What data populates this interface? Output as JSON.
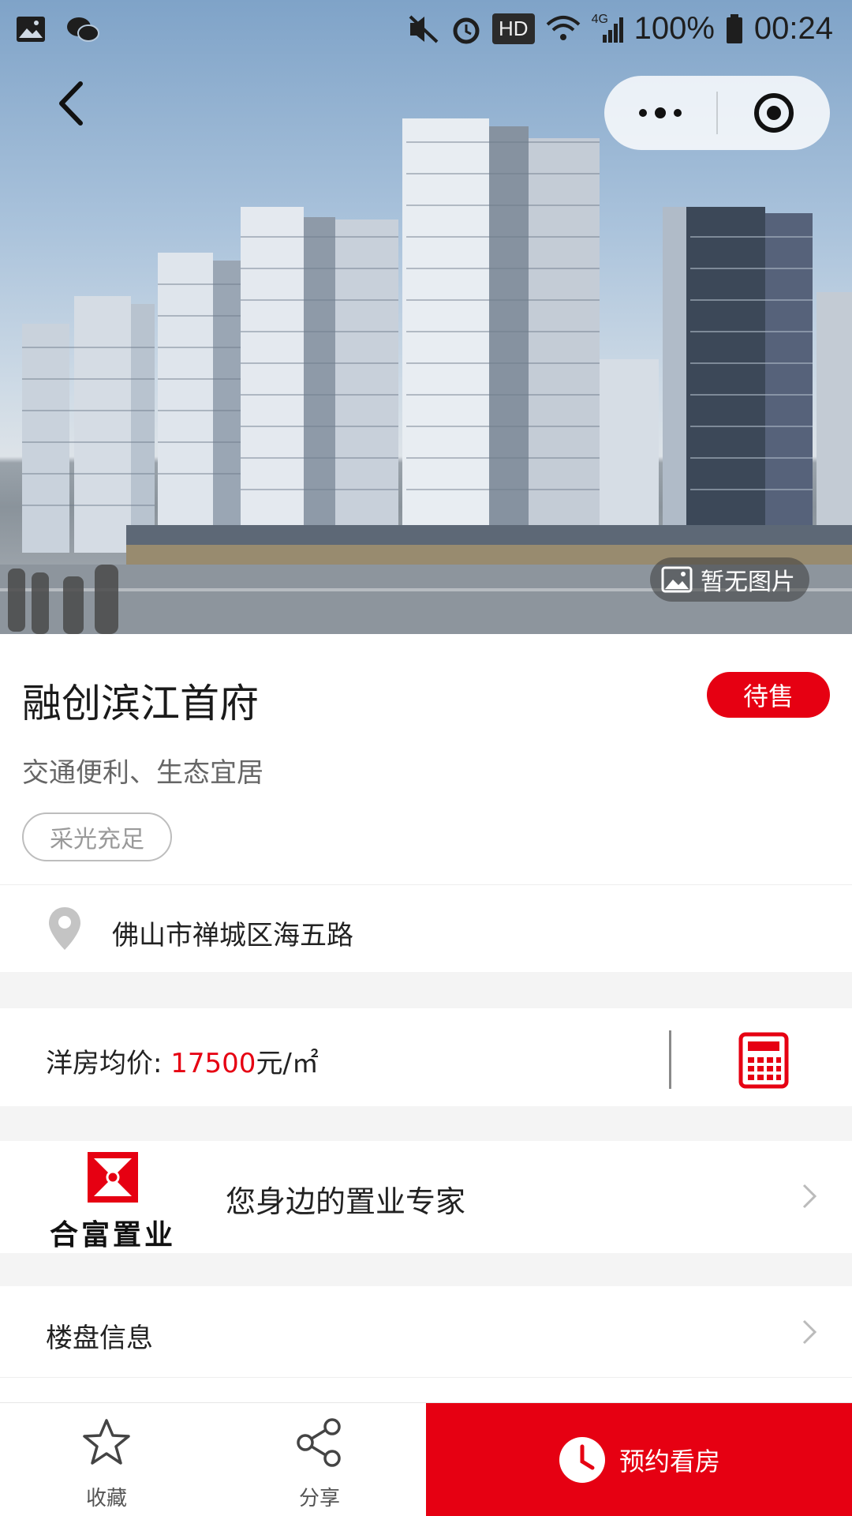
{
  "status_bar": {
    "battery": "100%",
    "time": "00:24",
    "network": "HD",
    "signal_type": "4G",
    "left_icons": [
      "image-notification-icon",
      "wechat-icon"
    ],
    "right_icons": [
      "mute-vibrate-icon",
      "alarm-icon",
      "wifi-icon",
      "signal-icon",
      "battery-icon"
    ]
  },
  "hero": {
    "placeholder_label": "暂无图片"
  },
  "project": {
    "name": "融创滨江首府",
    "status": "待售",
    "slogan": "交通便利、生态宜居",
    "tags": [
      "采光充足"
    ],
    "address": "佛山市禅城区海五路"
  },
  "price": {
    "label": "洋房均价: ",
    "value": "17500",
    "unit": "元/㎡"
  },
  "agency": {
    "logo_text": "合富置业",
    "tagline": "您身边的置业专家"
  },
  "info": {
    "label": "楼盘信息"
  },
  "bottom_bar": {
    "favorite_label": "收藏",
    "share_label": "分享",
    "book_label": "预约看房"
  },
  "colors": {
    "accent_red": "#e60012",
    "text_dark": "#222222",
    "text_gray": "#666666",
    "divider_gray": "#f4f4f4"
  }
}
